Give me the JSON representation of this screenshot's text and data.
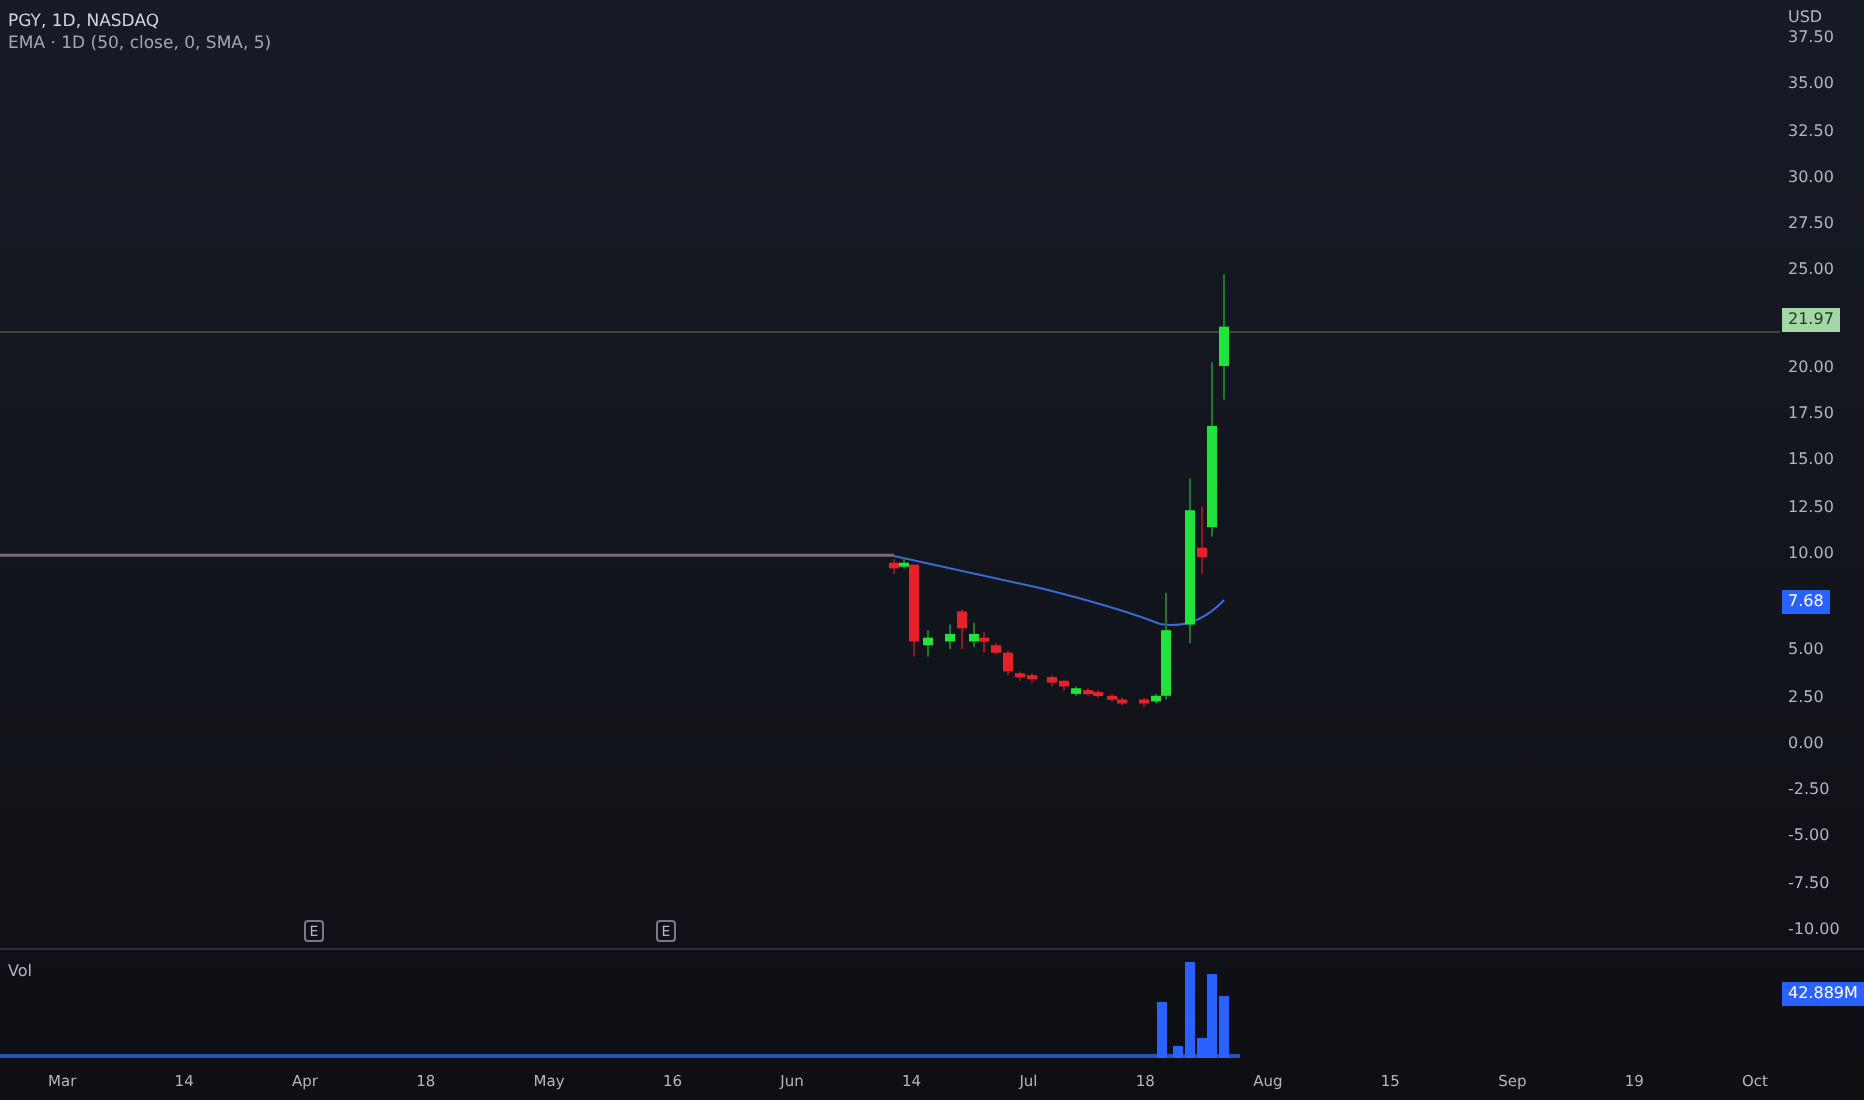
{
  "legend": {
    "symbol": "PGY, 1D, NASDAQ",
    "indicator": "EMA · 1D (50, close, 0, SMA, 5)"
  },
  "price_axis": {
    "unit": "USD",
    "labels": [
      {
        "kind": "tick",
        "label": "37.50"
      },
      {
        "kind": "tick",
        "label": "35.00"
      },
      {
        "kind": "tick",
        "label": "32.50"
      },
      {
        "kind": "tick",
        "label": "30.00"
      },
      {
        "kind": "tick",
        "label": "27.50"
      },
      {
        "kind": "tick",
        "label": "25.00"
      },
      {
        "kind": "last_price",
        "label": "21.97"
      },
      {
        "kind": "tick",
        "label": "20.00"
      },
      {
        "kind": "tick",
        "label": "17.50"
      },
      {
        "kind": "tick",
        "label": "15.00"
      },
      {
        "kind": "tick",
        "label": "12.50"
      },
      {
        "kind": "tick",
        "label": "10.00"
      },
      {
        "kind": "ema",
        "label": "7.68"
      },
      {
        "kind": "tick",
        "label": "5.00"
      },
      {
        "kind": "tick",
        "label": "2.50"
      },
      {
        "kind": "tick",
        "label": "0.00"
      },
      {
        "kind": "tick",
        "label": "-2.50"
      },
      {
        "kind": "tick",
        "label": "-5.00"
      },
      {
        "kind": "tick",
        "label": "-7.50"
      },
      {
        "kind": "tick",
        "label": "-10.00"
      }
    ]
  },
  "event_markers": [
    "E",
    "E"
  ],
  "volume": {
    "title": "Vol",
    "tag": "42.889M"
  },
  "time_axis": [
    "Mar",
    "14",
    "Apr",
    "18",
    "May",
    "16",
    "Jun",
    "14",
    "Jul",
    "18",
    "Aug",
    "15",
    "Sep",
    "19",
    "Oct"
  ]
}
